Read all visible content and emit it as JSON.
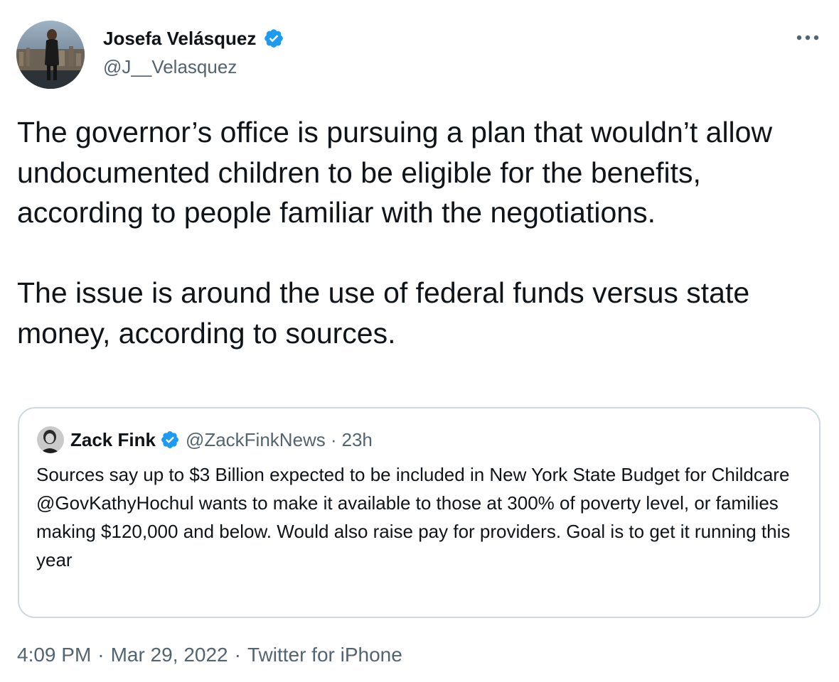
{
  "author": {
    "name": "Josefa Velásquez",
    "handle": "@J__Velasquez",
    "verified": true,
    "avatar": "profile-photo"
  },
  "more_icon": "more-icon",
  "tweet": {
    "paragraphs": [
      "The governor’s office is pursuing a plan that wouldn’t allow undocumented children to be eligible for the benefits, according to people familiar with the negotiations.",
      "The issue is around the use of federal funds versus state money, according to sources."
    ]
  },
  "quoted_tweet": {
    "name": "Zack Fink",
    "handle": "@ZackFinkNews",
    "separator": "·",
    "time": "23h",
    "verified": true,
    "lines": [
      "Sources say up to $3 Billion expected to be included in New York State Budget for Childcare",
      "@GovKathyHochul wants to make it available to those at 300% of poverty level, or families making $120,000 and below. Would also raise pay for providers. Goal is to get it running this year"
    ]
  },
  "meta": {
    "time": "4:09 PM",
    "date": "Mar 29, 2022",
    "source": "Twitter for iPhone",
    "separator": "·"
  },
  "colors": {
    "verified_blue": "#1d9bf0",
    "text_primary": "#0f1419",
    "text_secondary": "#536471",
    "border": "#cfd9de"
  }
}
